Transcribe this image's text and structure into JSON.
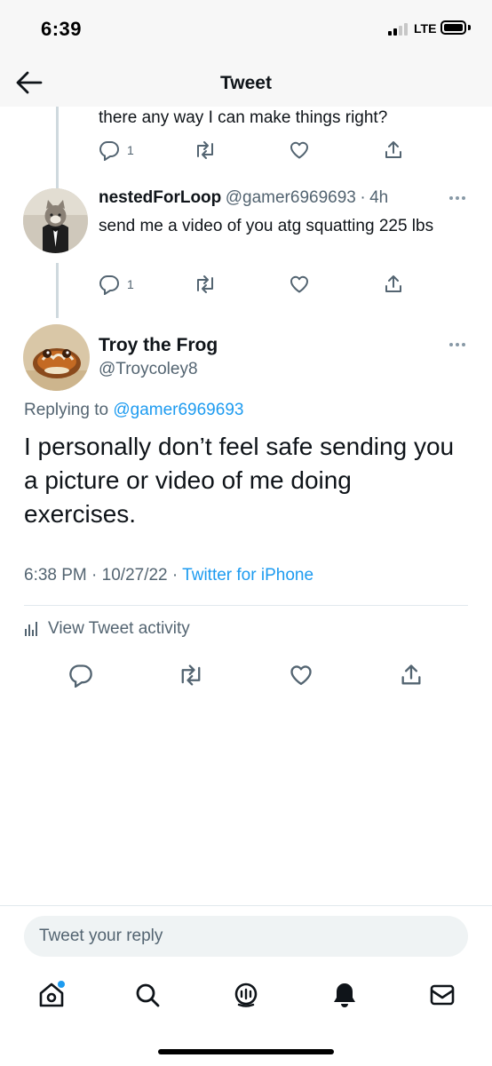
{
  "status_bar": {
    "time": "6:39",
    "network": "LTE",
    "signal_bars": 2,
    "signal_total": 4
  },
  "header": {
    "title": "Tweet"
  },
  "thread": {
    "previous_tweet": {
      "text_tail": "there any way I can make things right?",
      "replies": "1"
    },
    "reply_tweet": {
      "display_name": "nestedForLoop",
      "handle": "@gamer6969693",
      "separator": "·",
      "age": "4h",
      "text": "send me a video of you atg squatting 225 lbs",
      "replies": "1"
    }
  },
  "main_tweet": {
    "display_name": "Troy the Frog",
    "handle": "@Troycoley8",
    "replying_label": "Replying to",
    "replying_handle": "@gamer6969693",
    "text": "I personally don’t feel safe sending you a picture or video of me doing exercises.",
    "time": "6:38 PM",
    "dot1": "·",
    "date": "10/27/22",
    "dot2": "·",
    "source": "Twitter for iPhone",
    "activity_label": "View Tweet activity"
  },
  "reply_input": {
    "placeholder": "Tweet your reply"
  },
  "nav": {
    "items": [
      "home-icon",
      "search-icon",
      "spaces-icon",
      "notifications-icon",
      "messages-icon"
    ]
  },
  "colors": {
    "accent": "#1d9bf0",
    "text": "#0f1419",
    "secondary": "#536471"
  }
}
